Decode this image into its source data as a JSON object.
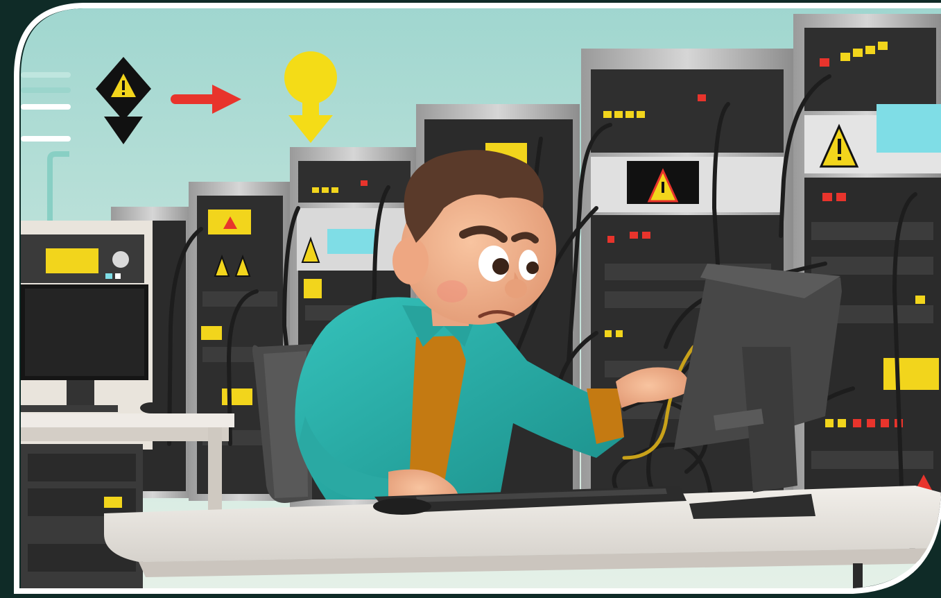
{
  "scene": {
    "subject": "technician-at-server-racks",
    "monitor_bezel_text": "",
    "colors": {
      "frame_background": "#0f2b27",
      "sky_top": "#a9d9d2",
      "sky_bottom": "#d7ece2",
      "shirt": "#2bb3ad",
      "undershirt": "#c47a12",
      "skin": "#f2b38e",
      "hair": "#5a3a2a",
      "rack_metal": "#cfcfcf",
      "rack_face": "#2d2d2d",
      "warning_yellow": "#f2d51c",
      "alert_red": "#e8342c",
      "screen_cyan": "#7fdde6",
      "desk_top": "#ece9e4",
      "cable": "#1d1d1d"
    },
    "icons": [
      "warning-diamond-down-arrow-icon",
      "red-right-arrow-icon",
      "yellow-pin-down-arrow-icon",
      "warning-triangle-icon"
    ]
  }
}
